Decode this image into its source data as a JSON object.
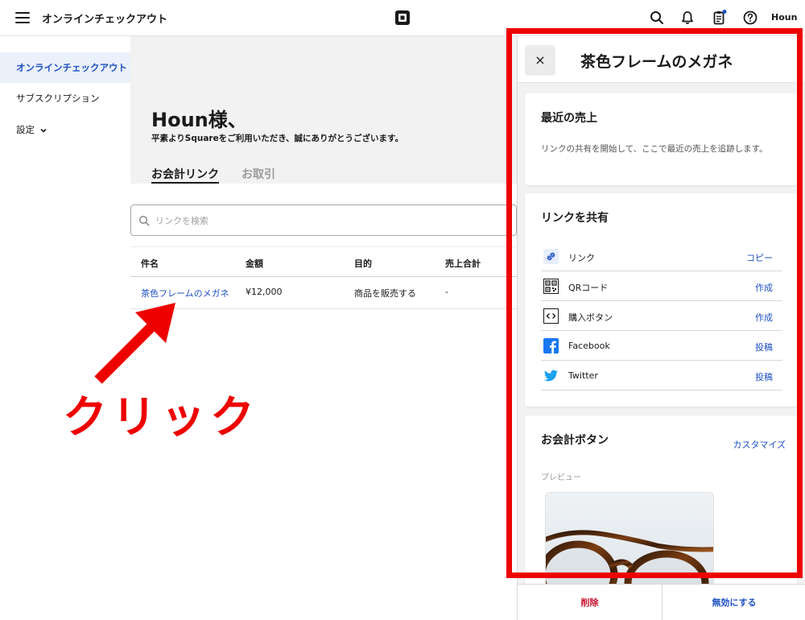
{
  "topbar": {
    "title": "オンラインチェックアウト",
    "user": "Houn",
    "icons": [
      "menu-icon",
      "square-logo",
      "search-icon",
      "bell-icon",
      "clipboard-icon",
      "help-icon"
    ],
    "notification_dot_color": "#1e51c4"
  },
  "sidebar": {
    "items": [
      {
        "label": "オンラインチェックアウト",
        "active": true
      },
      {
        "label": "サブスクリプション",
        "active": false
      },
      {
        "label": "設定",
        "active": false
      }
    ]
  },
  "main": {
    "greeting": "Houn様、",
    "greeting_sub": "平素よりSquareをご利用いただき、誠にありがとうございます。",
    "tabs": [
      {
        "label": "お会計リンク",
        "active": true
      },
      {
        "label": "お取引",
        "active": false
      }
    ],
    "search_placeholder": "リンクを検索",
    "table": {
      "headers": [
        "件名",
        "金額",
        "目的",
        "売上合計"
      ],
      "rows": [
        {
          "name": "茶色フレームのメガネ",
          "amount": "¥12,000",
          "purpose": "商品を販売する",
          "sales": "-"
        }
      ]
    }
  },
  "panel": {
    "close": "×",
    "title": "茶色フレームのメガネ",
    "recent_sales": {
      "title": "最近の売上",
      "text": "リンクの共有を開始して、ここで最近の売上を追跡します。"
    },
    "share": {
      "title": "リンクを共有",
      "rows": [
        {
          "label": "リンク",
          "action": "コピー",
          "icon": "link-icon"
        },
        {
          "label": "QRコード",
          "action": "作成",
          "icon": "qr-code-icon"
        },
        {
          "label": "購入ボタン",
          "action": "作成",
          "icon": "code-icon"
        },
        {
          "label": "Facebook",
          "action": "投稿",
          "icon": "facebook-icon"
        },
        {
          "label": "Twitter",
          "action": "投稿",
          "icon": "twitter-icon"
        }
      ]
    },
    "checkout_button": {
      "title": "お会計ボタン",
      "customize": "カスタマイズ",
      "preview_label": "プレビュー"
    },
    "footer": {
      "delete": "削除",
      "disable": "無効にする"
    }
  },
  "annotation": {
    "text": "クリック",
    "color": "#ee0000"
  },
  "colors": {
    "accent": "#1e51c4",
    "danger": "#c8102e",
    "annotation": "#ee0000"
  }
}
